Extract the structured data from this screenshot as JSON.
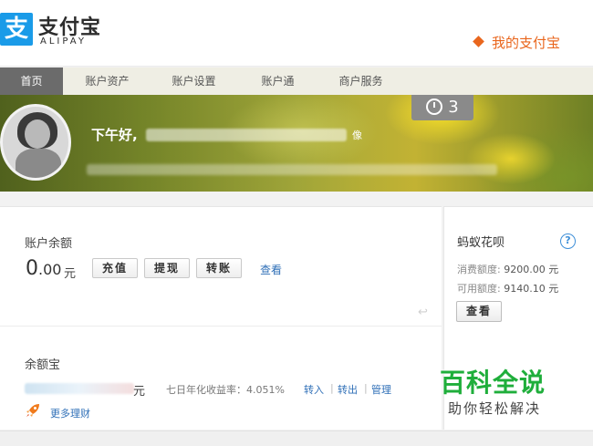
{
  "header": {
    "logo_cn": "支付宝",
    "logo_en": "ALIPAY",
    "logo_mark": "支",
    "my_alipay": "我的支付宝"
  },
  "nav": {
    "items": [
      "首页",
      "账户资产",
      "账户设置",
      "账户通",
      "商户服务"
    ],
    "active_index": 0
  },
  "banner": {
    "greeting": "下午好,",
    "greeting_tail": "像",
    "alarm_count": "3",
    "alarm_icon": "alarm-clock-icon"
  },
  "balance": {
    "label": "账户余额",
    "amount_int": "0",
    "amount_dec": ".00",
    "unit": "元",
    "buttons": [
      "充值",
      "提现",
      "转账"
    ],
    "view_link": "查看"
  },
  "huabei": {
    "title": "蚂蚁花呗",
    "help": "?",
    "consume_label": "消费额度:",
    "consume_value": "9200.00 元",
    "avail_label": "可用额度:",
    "avail_value": "9140.10 元",
    "view_button": "查看"
  },
  "yuebao": {
    "title": "余额宝",
    "unit": "元",
    "rate_text": "七日年化收益率：4.051%",
    "links": [
      "转入",
      "转出",
      "管理"
    ],
    "separator": "|",
    "more": "更多理财"
  },
  "watermark": {
    "big": "百科全说",
    "small": "助你轻松解决"
  },
  "colors": {
    "brand_blue": "#1a9be8",
    "accent_orange": "#e9661d",
    "link_blue": "#2f6fb7",
    "watermark_green": "#1fae3b"
  }
}
